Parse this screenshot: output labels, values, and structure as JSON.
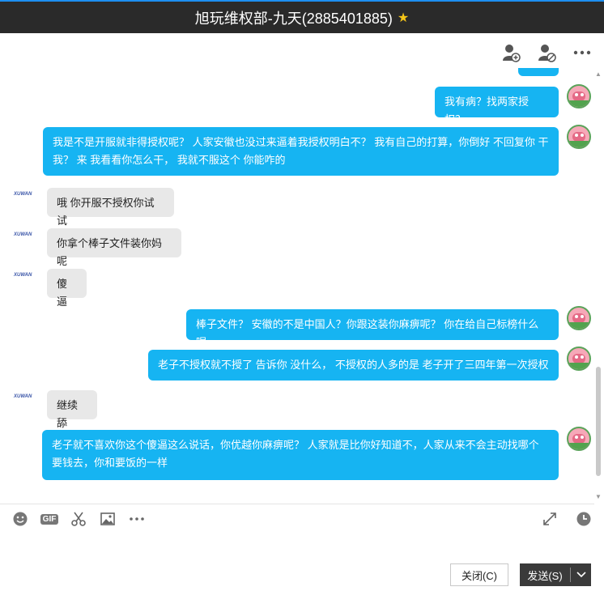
{
  "window": {
    "title": "旭玩维权部-九天(2885401885)",
    "star_icon": "star-icon",
    "accent_color": "#1e8ff0"
  },
  "top_toolbar": {
    "icons": [
      "add-member-icon",
      "block-user-icon",
      "more-icon"
    ]
  },
  "messages": [
    {
      "side": "out",
      "text": "我有病？找两家授权？"
    },
    {
      "side": "out",
      "text": "我是不是开服就非得授权呢？ 人家安徽也没过来逼着我授权明白不？ 我有自己的打算，你倒好 不回复你 干我？ 来 我看看你怎么干， 我就不服这个 你能咋的"
    },
    {
      "side": "in",
      "text": "哦 你开服不授权你试试"
    },
    {
      "side": "in",
      "text": "你拿个棒子文件装你妈呢"
    },
    {
      "side": "in",
      "text": "傻逼"
    },
    {
      "side": "out",
      "text": "棒子文件？ 安徽的不是中国人？你跟这装你麻痹呢？ 你在给自己标榜什么呢"
    },
    {
      "side": "out",
      "text": "老子不授权就不授了 告诉你 没什么， 不授权的人多的是 老子开了三四年第一次授权"
    },
    {
      "side": "in",
      "text": "继续舔"
    },
    {
      "side": "out",
      "text": "老子就不喜欢你这个傻逼这么说话，你优越你麻痹呢？ 人家就是比你好知道不，人家从来不会主动找哪个要钱去，你和要饭的一样"
    }
  ],
  "colors": {
    "bubble_out": "#16b4f2",
    "bubble_in": "#e8e8e8"
  },
  "input_toolbar": {
    "gif_label": "GIF",
    "left_icons": [
      "emoji-icon",
      "gif-icon",
      "scissors-icon",
      "image-icon",
      "more-icon"
    ],
    "right_icons": [
      "expand-icon",
      "history-clock-icon"
    ]
  },
  "buttons": {
    "close_label": "关闭(C)",
    "send_label": "发送(S)"
  }
}
